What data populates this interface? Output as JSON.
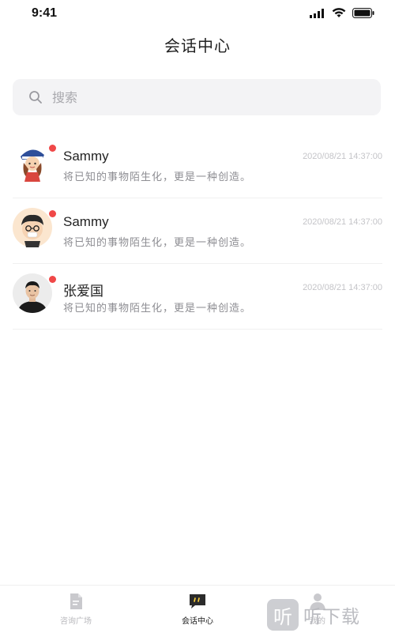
{
  "status_bar": {
    "time": "9:41"
  },
  "header": {
    "title": "会话中心"
  },
  "search": {
    "placeholder": "搜索",
    "value": ""
  },
  "conversations": [
    {
      "name": "Sammy",
      "time": "2020/08/21 14:37:00",
      "message": "将已知的事物陌生化，更是一种创造。",
      "unread": true,
      "avatar": "cartoon-girl-avatar"
    },
    {
      "name": "Sammy",
      "time": "2020/08/21 14:37:00",
      "message": "将已知的事物陌生化，更是一种创造。",
      "unread": true,
      "avatar": "cartoon-boy-avatar"
    },
    {
      "name": "张爱国",
      "time": "2020/08/21 14:37:00",
      "message": "将已知的事物陌生化，更是一种创造。",
      "unread": true,
      "avatar": "photo-man-avatar"
    }
  ],
  "tabbar": {
    "tabs": [
      {
        "label": "咨询广场",
        "icon": "document-icon",
        "active": false
      },
      {
        "label": "会话中心",
        "icon": "chat-bubble-icon",
        "active": true
      },
      {
        "label": "我的",
        "icon": "person-icon",
        "active": false
      }
    ]
  },
  "watermark": {
    "logo_char": "听",
    "text": "听下载"
  },
  "colors": {
    "unread_dot": "#f04848",
    "search_bg": "#f3f3f5",
    "active_tab": "#222222",
    "inactive_tab": "#b8b8bc"
  }
}
